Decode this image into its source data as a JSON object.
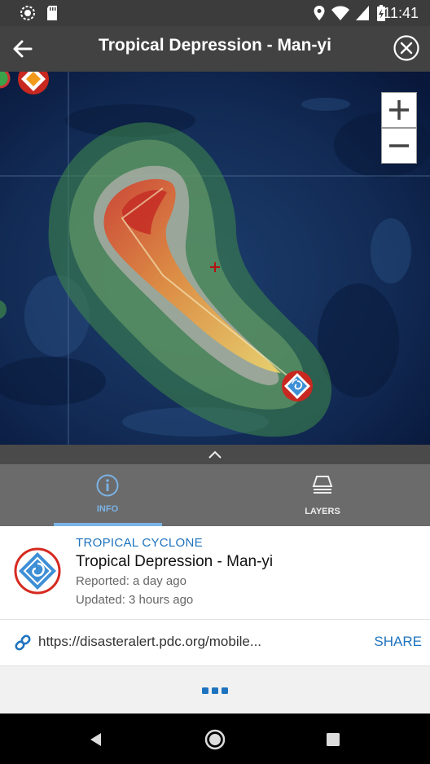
{
  "status_bar": {
    "time": "11:41"
  },
  "header": {
    "title": "Tropical Depression - Man-yi"
  },
  "tabs": [
    {
      "label": "INFO",
      "active": true
    },
    {
      "label": "LAYERS",
      "active": false
    }
  ],
  "info": {
    "category": "TROPICAL CYCLONE",
    "title": "Tropical Depression - Man-yi",
    "reported": "Reported: a day ago",
    "updated": "Updated: 3 hours ago"
  },
  "link": {
    "url": "https://disasteralert.pdc.org/mobile...",
    "share_label": "SHARE"
  },
  "colors": {
    "accent": "#1e73be",
    "tab_highlight": "#7bb3e6",
    "header_bg": "#424242"
  }
}
